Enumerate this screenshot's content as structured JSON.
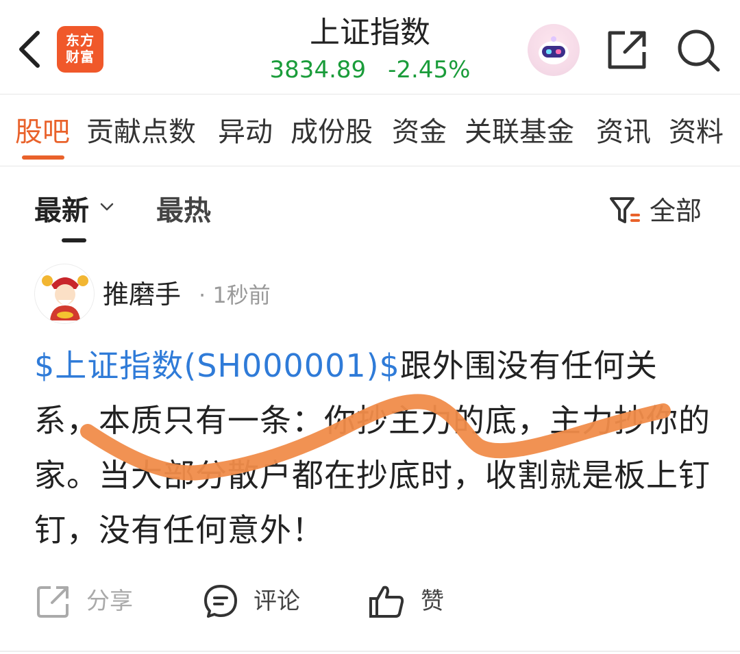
{
  "app": {
    "logo_text_line1": "东方",
    "logo_text_line2": "财富"
  },
  "header": {
    "title": "上证指数",
    "price": "3834.89",
    "change": "-2.45%",
    "quote_color": "#1a9c3a"
  },
  "tabs": [
    {
      "label": "股吧",
      "active": true
    },
    {
      "label": "贡献点数"
    },
    {
      "label": "异动"
    },
    {
      "label": "成份股"
    },
    {
      "label": "资金"
    },
    {
      "label": "关联基金"
    },
    {
      "label": "资讯"
    },
    {
      "label": "资料"
    }
  ],
  "sort": {
    "latest": "最新",
    "hot": "最热",
    "filter": "全部"
  },
  "post": {
    "user": "推磨手",
    "time": "· 1秒前",
    "stock_link": "$上证指数(SH000001)$",
    "text": "跟外围没有任何关系，本质只有一条：你抄主力的底，主力抄你的家。当大部分散户都在抄底时，收割就是板上钉钉，没有任何意外！"
  },
  "actions": {
    "share": "分享",
    "comment": "评论",
    "like": "赞"
  },
  "colors": {
    "accent": "#e9622b",
    "link": "#2f7bd8",
    "scribble": "#f08c4a",
    "brand": "#f0582a"
  }
}
